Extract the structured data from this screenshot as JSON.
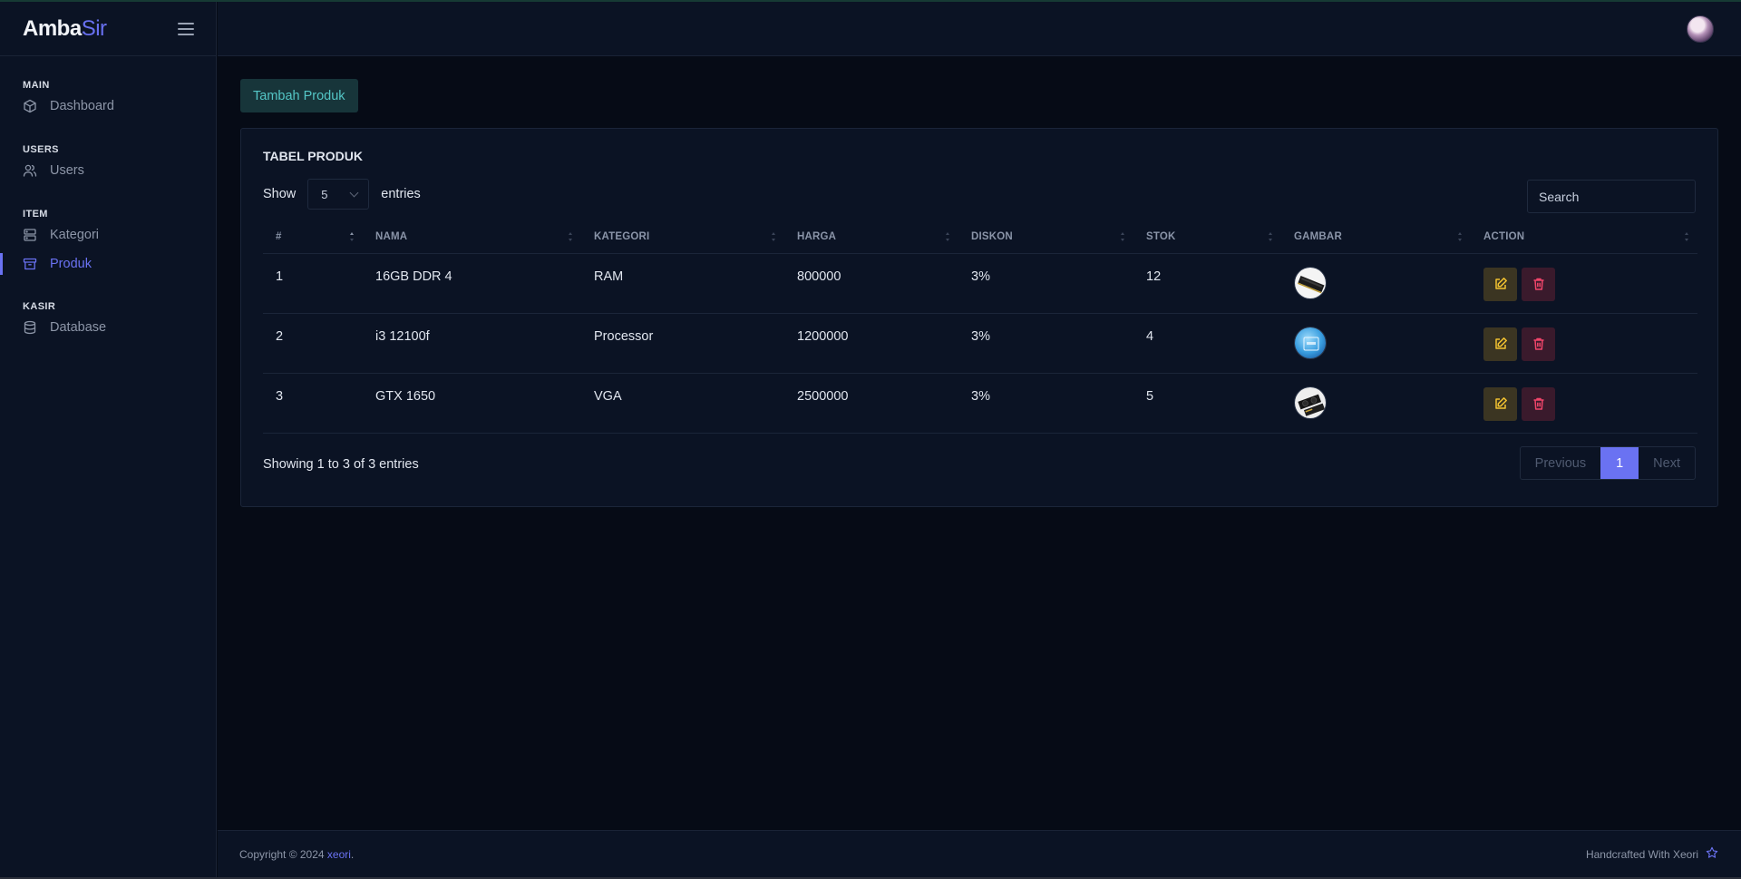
{
  "brand": {
    "part1": "Amba",
    "part2": "Sir"
  },
  "sidebar": {
    "sections": [
      {
        "heading": "MAIN",
        "items": [
          {
            "label": "Dashboard",
            "icon": "cube-icon"
          }
        ]
      },
      {
        "heading": "USERS",
        "items": [
          {
            "label": "Users",
            "icon": "users-icon"
          }
        ]
      },
      {
        "heading": "ITEM",
        "items": [
          {
            "label": "Kategori",
            "icon": "server-icon"
          },
          {
            "label": "Produk",
            "icon": "archive-icon",
            "active": true
          }
        ]
      },
      {
        "heading": "KASIR",
        "items": [
          {
            "label": "Database",
            "icon": "database-icon"
          }
        ]
      }
    ]
  },
  "main": {
    "add_button": "Tambah Produk",
    "card_title": "TABEL PRODUK",
    "show_label": "Show",
    "entries_value": "5",
    "entries_label": "entries",
    "search_placeholder": "Search",
    "columns": [
      "#",
      "NAMA",
      "KATEGORI",
      "HARGA",
      "DISKON",
      "STOK",
      "GAMBAR",
      "ACTION"
    ],
    "rows": [
      {
        "no": "1",
        "nama": "16GB DDR 4",
        "kategori": "RAM",
        "harga": "800000",
        "diskon": "3%",
        "stok": "12",
        "image": "ram-image"
      },
      {
        "no": "2",
        "nama": "i3 12100f",
        "kategori": "Processor",
        "harga": "1200000",
        "diskon": "3%",
        "stok": "4",
        "image": "processor-image"
      },
      {
        "no": "3",
        "nama": "GTX 1650",
        "kategori": "VGA",
        "harga": "2500000",
        "diskon": "3%",
        "stok": "5",
        "image": "vga-image"
      }
    ],
    "info": "Showing 1 to 3 of 3 entries",
    "pagination": {
      "previous": "Previous",
      "current": "1",
      "next": "Next"
    }
  },
  "footer": {
    "copyright": "Copyright © 2024 ",
    "author": "xeori",
    "period": ".",
    "handcrafted": "Handcrafted With Xeori"
  },
  "colors": {
    "accent": "#6a72f2",
    "teal": "#54c6c6",
    "edit": "#f2c230",
    "delete": "#f0456a",
    "background": "#060b16",
    "panel": "#0b1324"
  }
}
